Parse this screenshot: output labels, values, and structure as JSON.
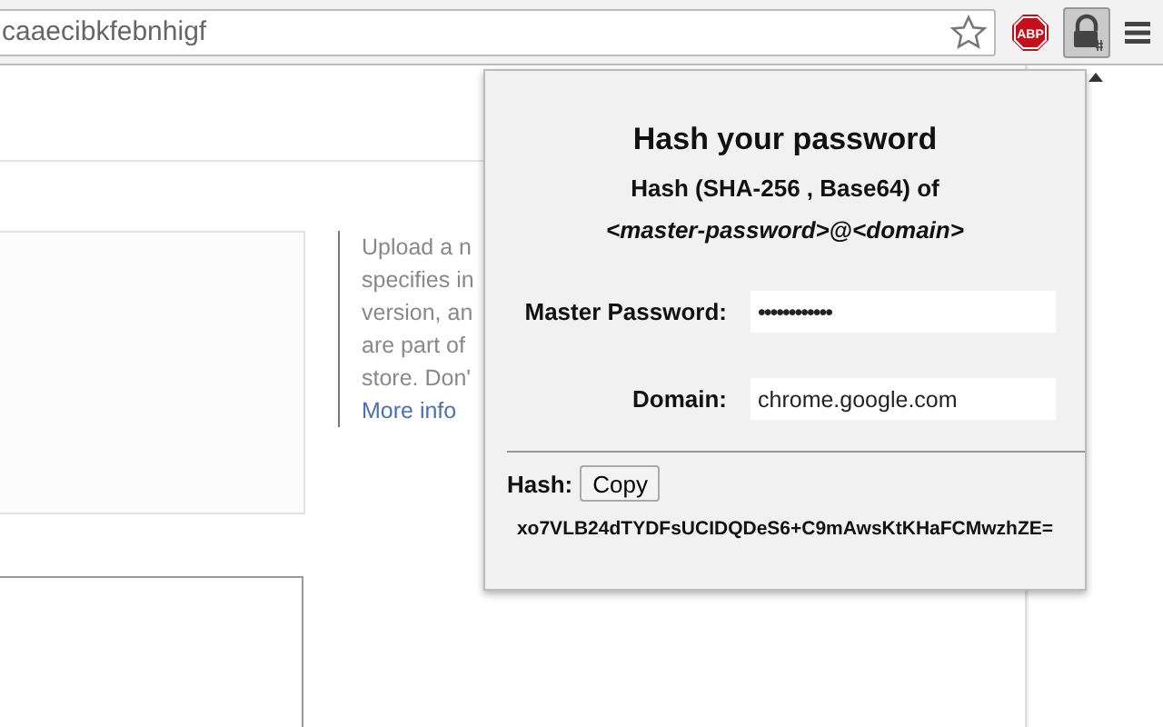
{
  "browser": {
    "address": "caaecibkfebnhigf",
    "adblock_badge": "ABP"
  },
  "page": {
    "description_lines": [
      "Upload a n",
      "specifies in",
      "version, an",
      "are part of",
      "store. Don'"
    ],
    "link": "More info"
  },
  "popup": {
    "title": "Hash your password",
    "subtitle": "Hash (SHA-256 , Base64) of",
    "formula": "*<master-password>*@*<domain>*",
    "fields": [
      {
        "label": "Master Password:",
        "value": "••••••••••••",
        "kind": "password"
      },
      {
        "label": "Domain:",
        "value": "chrome.google.com",
        "kind": "text"
      }
    ],
    "hash_label": "Hash:",
    "copy_button": "Copy",
    "hash": "xo7VLB24dTYDFsUCIDQDeS6+C9mAwsKtKHaFCMwzhZE="
  }
}
